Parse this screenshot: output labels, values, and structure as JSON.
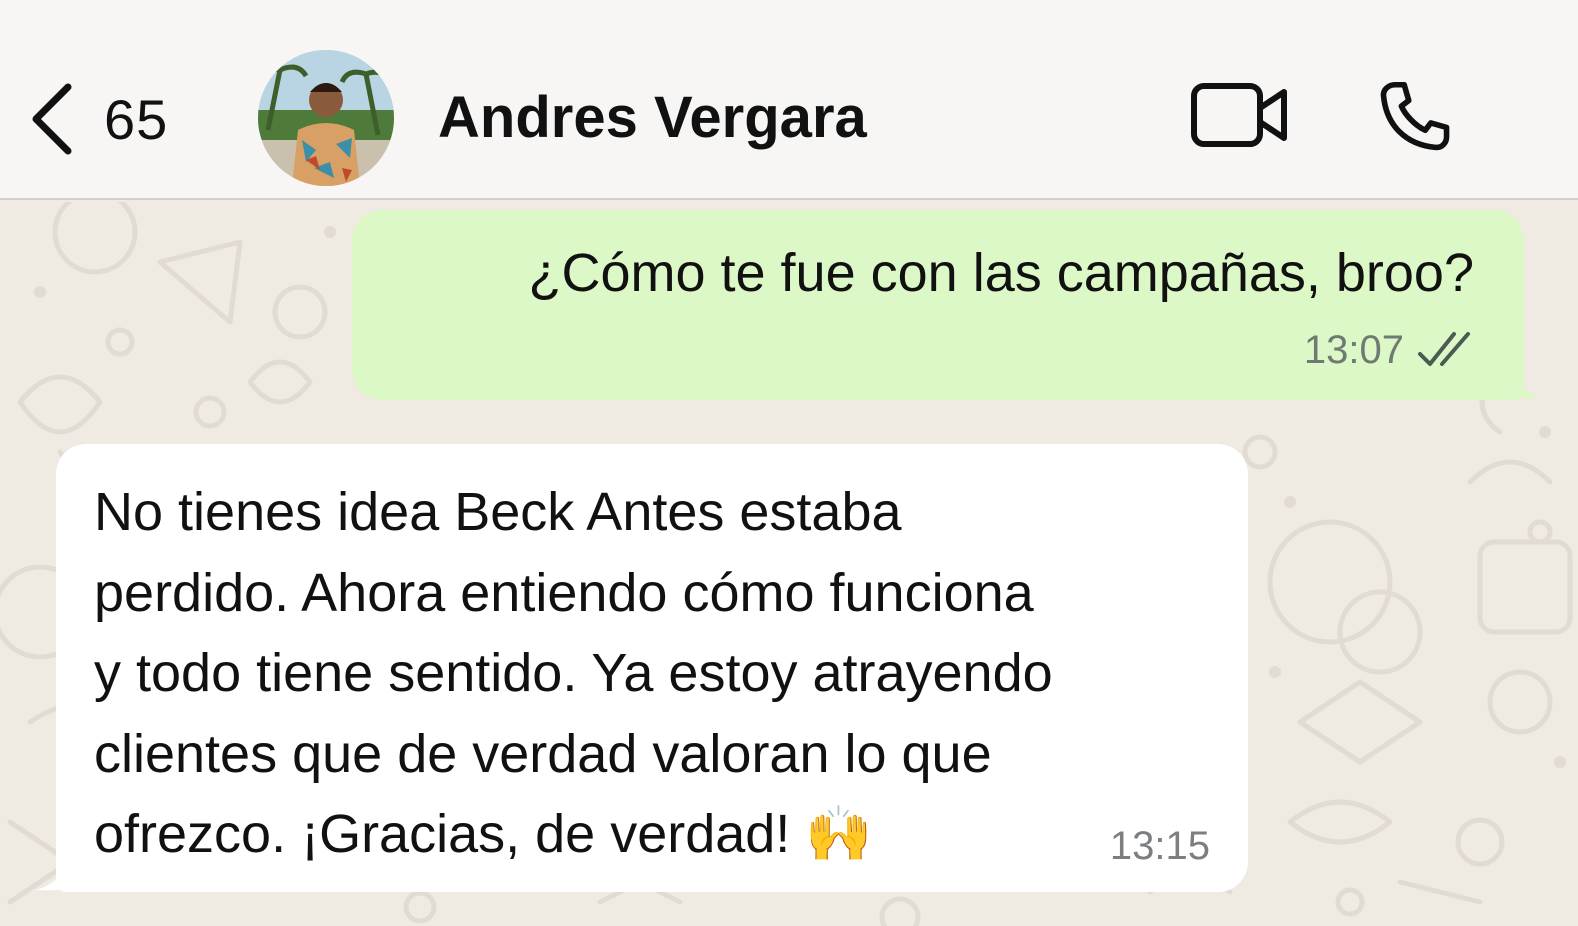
{
  "header": {
    "back_count": "65",
    "contact_name": "Andres Vergara"
  },
  "messages": [
    {
      "direction": "outgoing",
      "text": "¿Cómo te fue con las campañas, broo?",
      "time": "13:07",
      "status": "read"
    },
    {
      "direction": "incoming",
      "text": "No tienes idea Beck Antes estaba\nperdido. Ahora entiendo cómo funciona\ny todo tiene sentido. Ya estoy atrayendo\nclientes que de verdad valoran lo que\nofrezco. ¡Gracias, de verdad! 🙌",
      "time": "13:15"
    }
  ],
  "colors": {
    "wallpaper": "#efeae2",
    "header_bg": "#f7f6f5",
    "outgoing_bubble": "#dbf8c6",
    "incoming_bubble": "#ffffff",
    "read_ticks": "#4b5a52"
  },
  "icons": {
    "back": "chevron-left-icon",
    "video": "video-camera-icon",
    "call": "phone-icon",
    "status": "double-check-icon"
  }
}
